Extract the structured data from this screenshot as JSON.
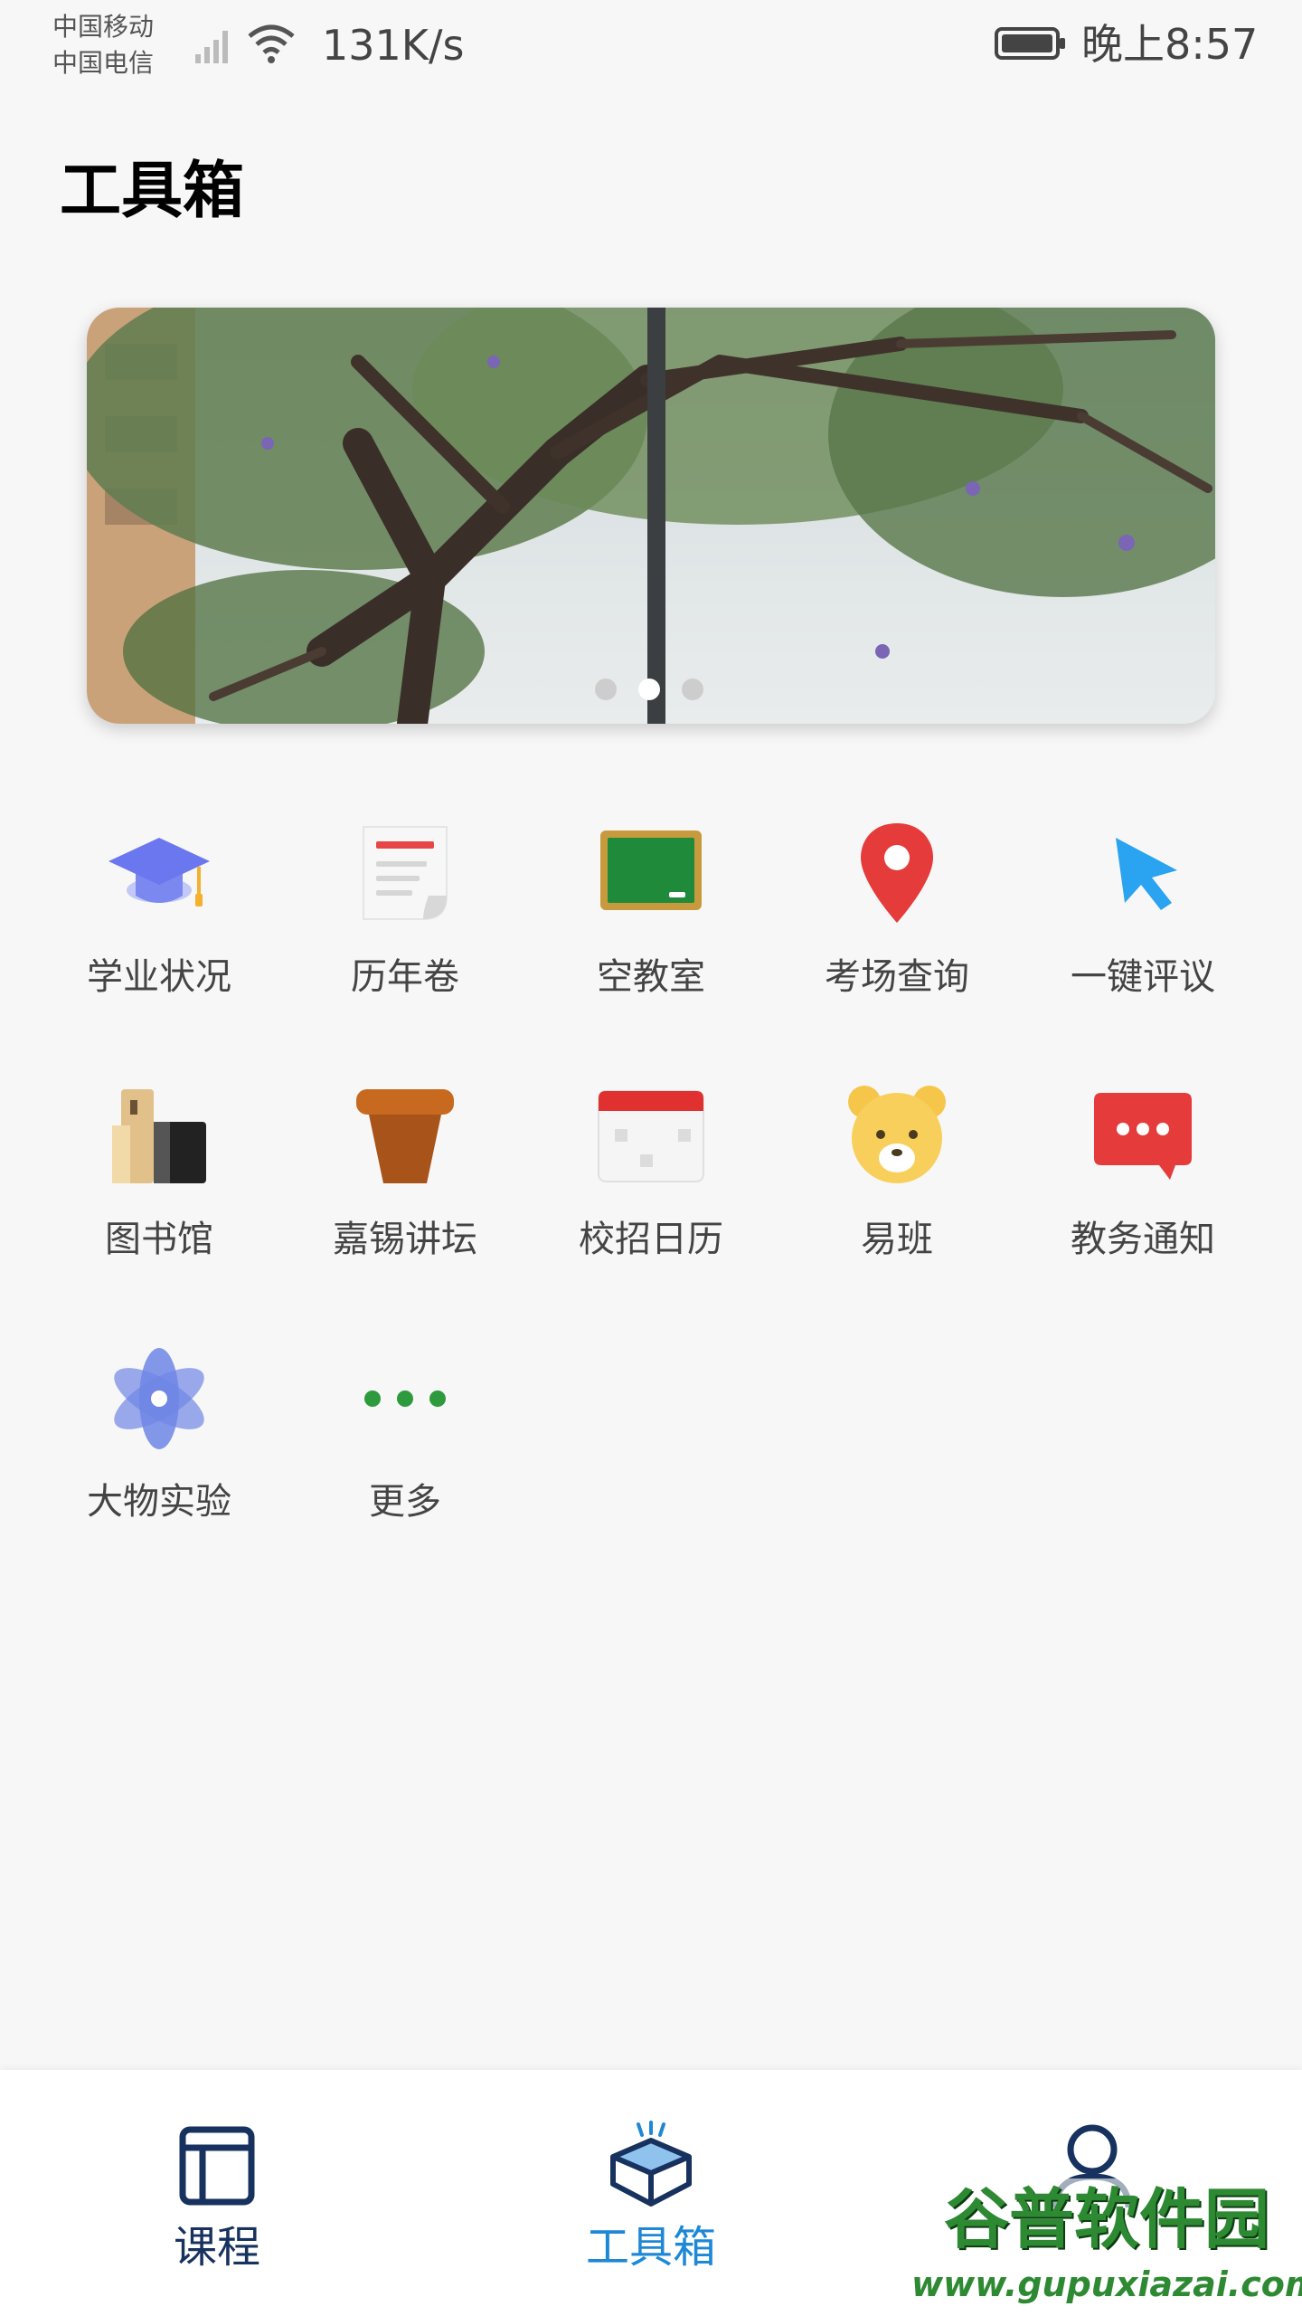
{
  "status_bar": {
    "carrier_1": "中国移动",
    "carrier_2": "中国电信",
    "net_speed": "131K/s",
    "time": "晚上8:57"
  },
  "header": {
    "title": "工具箱"
  },
  "banner": {
    "dot_count": 3,
    "active_index": 1
  },
  "tools": [
    {
      "label": "学业状况",
      "icon": "graduation-cap-icon"
    },
    {
      "label": "历年卷",
      "icon": "exam-paper-icon"
    },
    {
      "label": "空教室",
      "icon": "blackboard-icon"
    },
    {
      "label": "考场查询",
      "icon": "location-pin-icon"
    },
    {
      "label": "一键评议",
      "icon": "cursor-pointer-icon"
    },
    {
      "label": "图书馆",
      "icon": "library-icon"
    },
    {
      "label": "嘉锡讲坛",
      "icon": "lectern-icon"
    },
    {
      "label": "校招日历",
      "icon": "calendar-icon"
    },
    {
      "label": "易班",
      "icon": "bear-icon"
    },
    {
      "label": "教务通知",
      "icon": "message-bubble-icon"
    },
    {
      "label": "大物实验",
      "icon": "atom-icon"
    },
    {
      "label": "更多",
      "icon": "more-dots-icon"
    }
  ],
  "bottom_nav": {
    "items": [
      {
        "label": "课程",
        "icon": "course-layout-icon",
        "active": false
      },
      {
        "label": "工具箱",
        "icon": "toolbox-icon",
        "active": true
      },
      {
        "label": "",
        "icon": "user-profile-icon",
        "active": false
      }
    ]
  },
  "watermark": {
    "text": "谷普软件园",
    "url": "www.gupuxiazai.com"
  },
  "colors": {
    "background": "#f7f7f7",
    "nav_active": "#1e88d6",
    "nav_inactive": "#17325e",
    "label": "#444444"
  }
}
